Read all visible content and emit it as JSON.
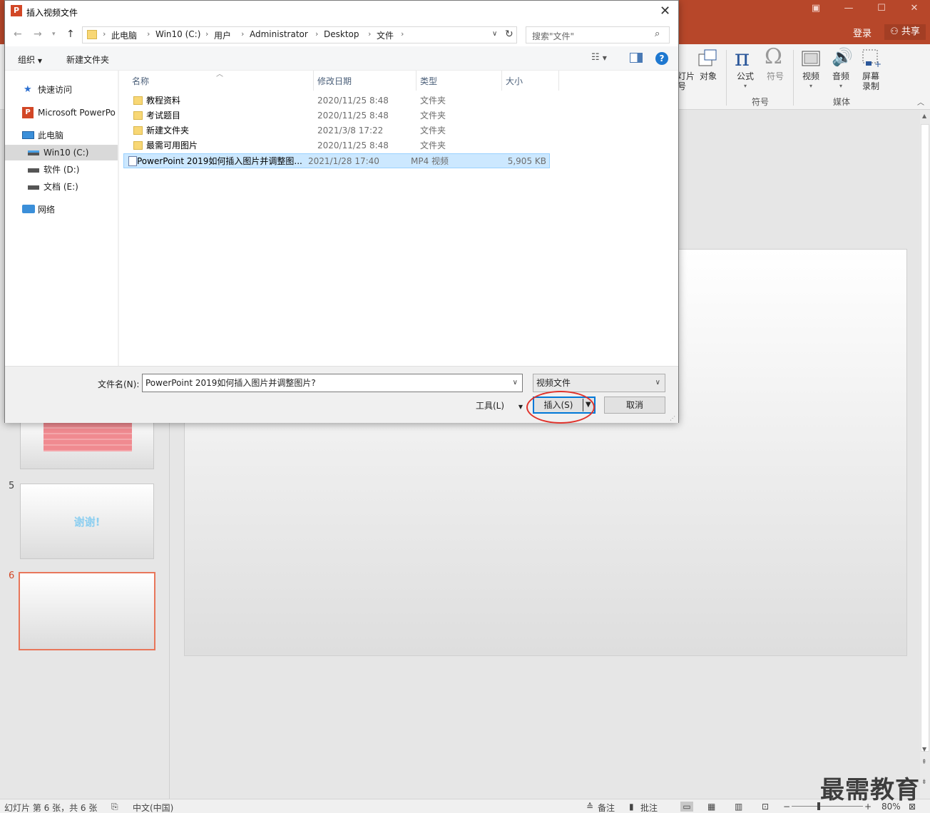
{
  "powerpoint": {
    "login": "登录",
    "share": "共享",
    "ribbon": {
      "partial_slide_number": "灯片\n号",
      "object": "对象",
      "equation": "公式",
      "symbol": "符号",
      "group_symbols": "符号",
      "video": "视频",
      "audio": "音频",
      "screen_recording": "屏幕\n录制",
      "group_media": "媒体"
    },
    "slides": [
      {
        "number": "5",
        "text": "谢谢!"
      },
      {
        "number": "6"
      }
    ],
    "status": {
      "slide_info": "幻灯片 第 6 张，共 6 张",
      "language": "中文(中国)",
      "notes": "备注",
      "comments": "批注",
      "zoom": "80%"
    },
    "watermark": "最需教育"
  },
  "dialog": {
    "title": "插入视频文件",
    "breadcrumbs": [
      "此电脑",
      "Win10 (C:)",
      "用户",
      "Administrator",
      "Desktop",
      "文件"
    ],
    "search_placeholder": "搜索\"文件\"",
    "toolbar": {
      "organize": "组织",
      "new_folder": "新建文件夹"
    },
    "nav": {
      "quick_access": "快速访问",
      "powerpoint": "Microsoft PowerPo",
      "this_pc": "此电脑",
      "drive_c": "Win10 (C:)",
      "drive_d": "软件 (D:)",
      "drive_e": "文档 (E:)",
      "network": "网络"
    },
    "columns": {
      "name": "名称",
      "date": "修改日期",
      "type": "类型",
      "size": "大小"
    },
    "files": [
      {
        "name": "教程资料",
        "date": "2020/11/25 8:48",
        "type": "文件夹",
        "size": ""
      },
      {
        "name": "考试题目",
        "date": "2020/11/25 8:48",
        "type": "文件夹",
        "size": ""
      },
      {
        "name": "新建文件夹",
        "date": "2021/3/8 17:22",
        "type": "文件夹",
        "size": ""
      },
      {
        "name": "最需可用图片",
        "date": "2020/11/25 8:48",
        "type": "文件夹",
        "size": ""
      },
      {
        "name": "PowerPoint 2019如何插入图片并调整图...",
        "date": "2021/1/28 17:40",
        "type": "MP4 视频",
        "size": "5,905 KB"
      }
    ],
    "filename_label": "文件名(N):",
    "filename_value": "PowerPoint 2019如何插入图片并调整图片?",
    "filetype": "视频文件",
    "tools": "工具(L)",
    "insert": "插入(S)",
    "cancel": "取消"
  }
}
